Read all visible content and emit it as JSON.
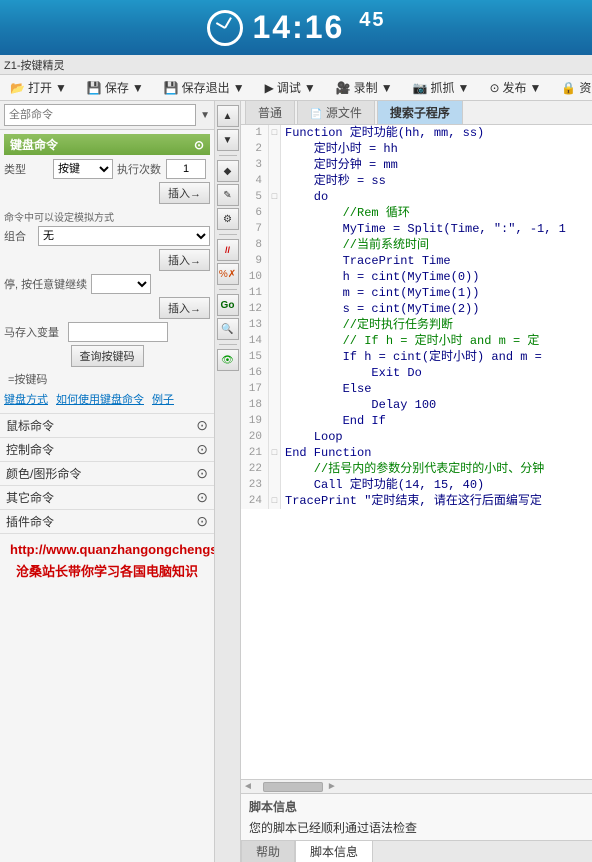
{
  "topbar": {
    "time": "14:16",
    "seconds": "45"
  },
  "titlebar": {
    "text": "Z1-按键精灵"
  },
  "menubar": {
    "items": [
      {
        "label": "打开",
        "icon": "folder-icon"
      },
      {
        "label": "保存",
        "icon": "save-icon"
      },
      {
        "label": "保存退出",
        "icon": "save-exit-icon"
      },
      {
        "label": "调试",
        "icon": "debug-icon"
      },
      {
        "label": "录制",
        "icon": "record-icon"
      },
      {
        "label": "抓抓",
        "icon": "capture-icon"
      },
      {
        "label": "发布",
        "icon": "publish-icon"
      },
      {
        "label": "资",
        "icon": "resource-icon"
      }
    ]
  },
  "leftpanel": {
    "search_placeholder": "全部命令",
    "keyboard_section_title": "键盘命令",
    "form": {
      "type_label": "类型",
      "type_value": "按键",
      "count_label": "执行次数",
      "count_value": "1",
      "insert_label": "插入→"
    },
    "note_text": "命令中可以设定模拟方式",
    "combo_label": "组合",
    "combo_value": "无",
    "insert2_label": "插入→",
    "stop_note": "停, 按任意键继续",
    "insert3_label": "插入→",
    "save_var_label": "马存入变量",
    "query_btn_label": "查询按键码",
    "query_result": "=按键码",
    "links": [
      "键盘方式",
      "如何使用键盘命令",
      "例子"
    ],
    "mouse_section": "鼠标命令",
    "control_section": "控制命令",
    "color_section": "颜色/图形命令",
    "other_section": "其它命令",
    "plugin_section": "插件命令",
    "url": "http://www.quanzhangongchengshi.com/",
    "subtitle": "沧桑站长带你学习各国电脑知识"
  },
  "vtoolbar": {
    "buttons": [
      "▲",
      "▼",
      "◆",
      "✎",
      "⚙",
      "Go",
      "🔍"
    ]
  },
  "editor": {
    "tabs": [
      {
        "label": "普通",
        "active": false
      },
      {
        "label": "源文件",
        "active": false
      },
      {
        "label": "搜索子程序",
        "active": true
      }
    ],
    "lines": [
      {
        "num": "1",
        "marker": "□",
        "content": "Function 定时功能(hh, mm, ss)"
      },
      {
        "num": "2",
        "marker": " ",
        "content": "    定时小时 = hh"
      },
      {
        "num": "3",
        "marker": " ",
        "content": "    定时分钟 = mm"
      },
      {
        "num": "4",
        "marker": " ",
        "content": "    定时秒 = ss"
      },
      {
        "num": "5",
        "marker": "□",
        "content": "    do"
      },
      {
        "num": "6",
        "marker": " ",
        "content": "        //Rem 循环"
      },
      {
        "num": "7",
        "marker": " ",
        "content": "        MyTime = Split(Time, \":\", -1, 1"
      },
      {
        "num": "8",
        "marker": " ",
        "content": "        //当前系统时间"
      },
      {
        "num": "9",
        "marker": " ",
        "content": "        TracePrint Time"
      },
      {
        "num": "10",
        "marker": " ",
        "content": "        h = cint(MyTime(0))"
      },
      {
        "num": "11",
        "marker": " ",
        "content": "        m = cint(MyTime(1))"
      },
      {
        "num": "12",
        "marker": " ",
        "content": "        s = cint(MyTime(2))"
      },
      {
        "num": "13",
        "marker": " ",
        "content": "        //定时执行任务判断"
      },
      {
        "num": "14",
        "marker": " ",
        "content": "        // If h = 定时小时 and m = 定"
      },
      {
        "num": "15",
        "marker": " ",
        "content": "        If h = cint(定时小时) and m ="
      },
      {
        "num": "16",
        "marker": " ",
        "content": "            Exit Do"
      },
      {
        "num": "17",
        "marker": " ",
        "content": "        Else"
      },
      {
        "num": "18",
        "marker": " ",
        "content": "            Delay 100"
      },
      {
        "num": "19",
        "marker": " ",
        "content": "        End If"
      },
      {
        "num": "20",
        "marker": " ",
        "content": "    Loop"
      },
      {
        "num": "21",
        "marker": "□",
        "content": "End Function"
      },
      {
        "num": "22",
        "marker": " ",
        "content": "    //括号内的参数分别代表定时的小时、分钟"
      },
      {
        "num": "23",
        "marker": " ",
        "content": "    Call 定时功能(14, 15, 40)"
      },
      {
        "num": "24",
        "marker": "□",
        "content": "TracePrint \"定时结束, 请在这行后面编写定"
      }
    ]
  },
  "bottom": {
    "go_btn": "Go",
    "search_btn": "🔍",
    "script_info_title": "脚本信息",
    "script_info_text": "您的脚本已经顺利通过语法检查",
    "tabs": [
      {
        "label": "帮助",
        "active": false
      },
      {
        "label": "脚本信息",
        "active": true
      }
    ]
  }
}
